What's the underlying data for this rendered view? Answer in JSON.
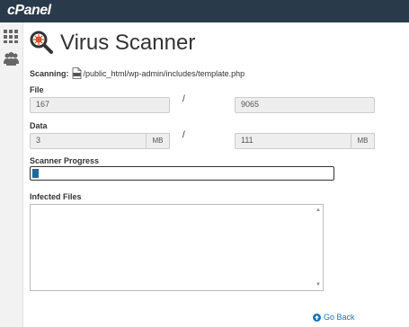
{
  "header": {
    "logo": "cPanel"
  },
  "sidebar": {
    "items": [
      {
        "icon": "grid-icon"
      },
      {
        "icon": "users-icon"
      }
    ]
  },
  "page": {
    "title": "Virus Scanner"
  },
  "scanning": {
    "label": "Scanning:",
    "path": "/public_html/wp-admin/includes/template.php"
  },
  "file": {
    "label": "File",
    "scanned": "167",
    "separator": "/",
    "total": "9065"
  },
  "data": {
    "label": "Data",
    "scanned": "3",
    "scanned_unit": "MB",
    "separator": "/",
    "total": "111",
    "total_unit": "MB"
  },
  "progress": {
    "label": "Scanner Progress",
    "fraction": 0.02
  },
  "infected": {
    "label": "Infected Files",
    "value": ""
  },
  "footer": {
    "go_back": "Go Back"
  },
  "colors": {
    "topbar": "#293a4a",
    "progress": "#1e6a9c",
    "link": "#1a72b8"
  }
}
